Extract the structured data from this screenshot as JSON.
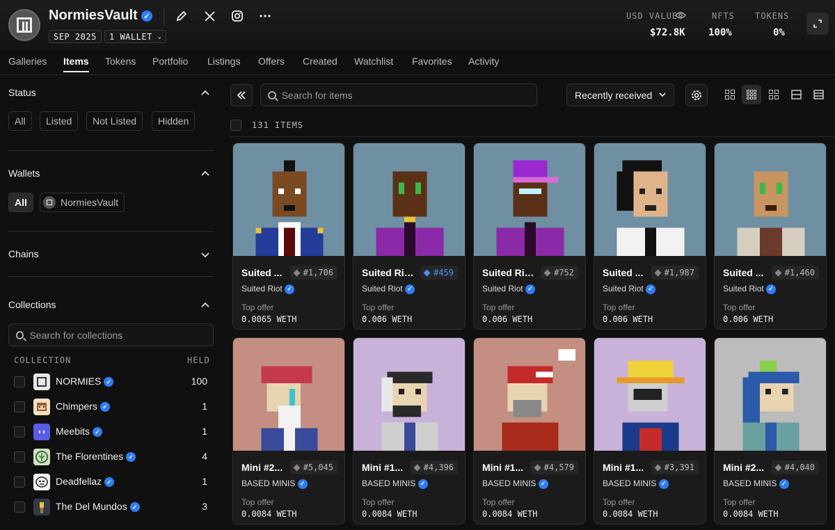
{
  "header": {
    "vault_name": "NormiesVault",
    "date_chip": "SEP 2025",
    "wallet_chip": "1 WALLET",
    "stats": [
      {
        "label": "USD VALUE",
        "value": "$72.8K"
      },
      {
        "label": "NFTS",
        "value": "100%"
      },
      {
        "label": "TOKENS",
        "value": "0%"
      }
    ]
  },
  "tabs": [
    "Galleries",
    "Items",
    "Tokens",
    "Portfolio",
    "Listings",
    "Offers",
    "Created",
    "Watchlist",
    "Favorites",
    "Activity"
  ],
  "active_tab": "Items",
  "sidebar": {
    "status": {
      "title": "Status",
      "options": [
        "All",
        "Listed",
        "Not Listed",
        "Hidden"
      ]
    },
    "wallets": {
      "title": "Wallets",
      "all_label": "All",
      "wallet_name": "NormiesVault"
    },
    "chains": {
      "title": "Chains"
    },
    "collections": {
      "title": "Collections",
      "search_placeholder": "Search for collections",
      "col_collection": "COLLECTION",
      "col_held": "HELD",
      "items": [
        {
          "name": "NORMIES",
          "held": "100"
        },
        {
          "name": "Chimpers",
          "held": "1"
        },
        {
          "name": "Meebits",
          "held": "1"
        },
        {
          "name": "The Florentines",
          "held": "4"
        },
        {
          "name": "Deadfellaz",
          "held": "1"
        },
        {
          "name": "The Del Mundos",
          "held": "3"
        }
      ]
    }
  },
  "main": {
    "search_placeholder": "Search for items",
    "sort_label": "Recently received",
    "item_count": "131 ITEMS",
    "cards": [
      {
        "title": "Suited ...",
        "token": "#1,706",
        "collection": "Suited Riot",
        "offer_label": "Top offer",
        "offer": "0.0065 WETH"
      },
      {
        "title": "Suited Rio...",
        "token": "#459",
        "collection": "Suited Riot",
        "offer_label": "Top offer",
        "offer": "0.006 WETH"
      },
      {
        "title": "Suited Rio...",
        "token": "#752",
        "collection": "Suited Riot",
        "offer_label": "Top offer",
        "offer": "0.006 WETH"
      },
      {
        "title": "Suited ...",
        "token": "#1,987",
        "collection": "Suited Riot",
        "offer_label": "Top offer",
        "offer": "0.006 WETH"
      },
      {
        "title": "Suited ...",
        "token": "#1,460",
        "collection": "Suited Riot",
        "offer_label": "Top offer",
        "offer": "0.006 WETH"
      },
      {
        "title": "Mini #2...",
        "token": "#5,045",
        "collection": "BASED MINIS",
        "offer_label": "Top offer",
        "offer": "0.0084 WETH"
      },
      {
        "title": "Mini #1...",
        "token": "#4,396",
        "collection": "BASED MINIS",
        "offer_label": "Top offer",
        "offer": "0.0084 WETH"
      },
      {
        "title": "Mini #1...",
        "token": "#4,579",
        "collection": "BASED MINIS",
        "offer_label": "Top offer",
        "offer": "0.0084 WETH"
      },
      {
        "title": "Mini #1...",
        "token": "#3,391",
        "collection": "BASED MINIS",
        "offer_label": "Top offer",
        "offer": "0.0084 WETH"
      },
      {
        "title": "Mini #2...",
        "token": "#4,040",
        "collection": "BASED MINIS",
        "offer_label": "Top offer",
        "offer": "0.0084 WETH"
      }
    ]
  },
  "colors": {
    "accent_verified": "#2f7cf6",
    "card_bg_blue": "#6f8fa3",
    "card_bg_pink": "#c48f82",
    "card_bg_lilac": "#c8b2da",
    "card_bg_gray": "#bcbcbc"
  }
}
